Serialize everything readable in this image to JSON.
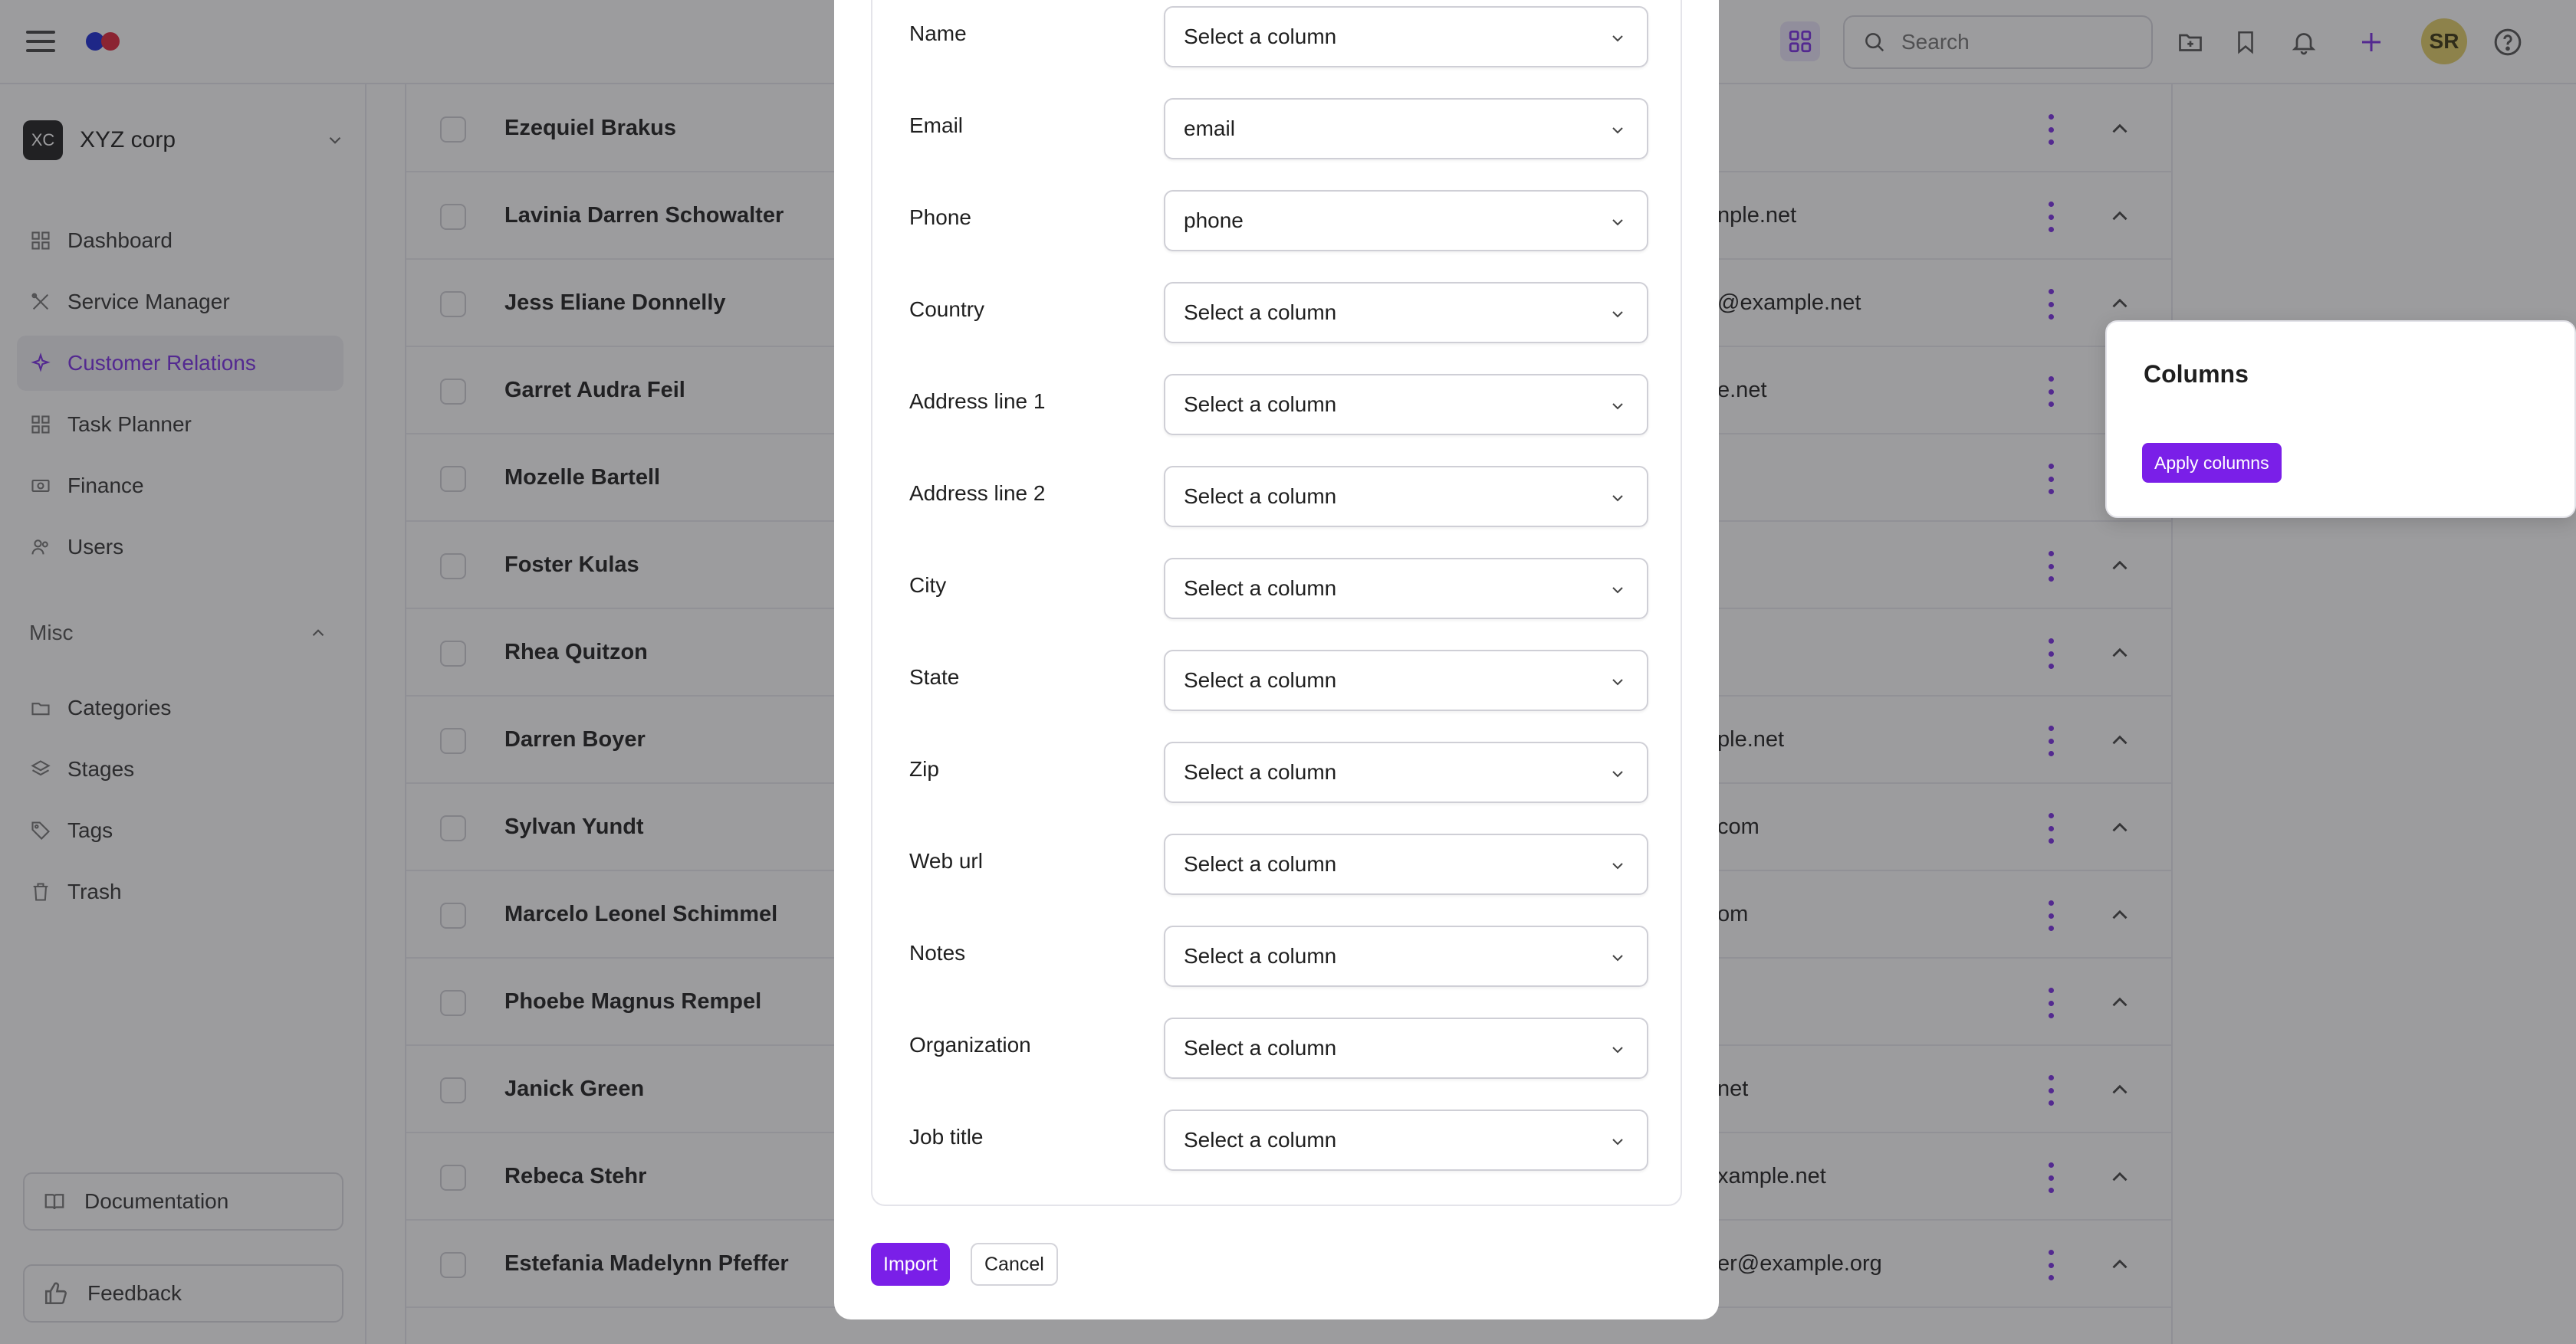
{
  "header": {
    "search_placeholder": "Search",
    "avatar_initials": "SR"
  },
  "sidebar": {
    "org_badge": "XC",
    "org_name": "XYZ corp",
    "nav": [
      {
        "label": "Dashboard",
        "icon": "grid-icon"
      },
      {
        "label": "Service Manager",
        "icon": "tools-icon"
      },
      {
        "label": "Customer Relations",
        "icon": "sparkle-icon",
        "active": true
      },
      {
        "label": "Task Planner",
        "icon": "grid-icon"
      },
      {
        "label": "Finance",
        "icon": "banknote-icon"
      },
      {
        "label": "Users",
        "icon": "users-icon"
      }
    ],
    "misc_label": "Misc",
    "misc": [
      {
        "label": "Categories",
        "icon": "folder-icon"
      },
      {
        "label": "Stages",
        "icon": "layers-icon"
      },
      {
        "label": "Tags",
        "icon": "tag-icon"
      },
      {
        "label": "Trash",
        "icon": "trash-icon"
      }
    ],
    "documentation": "Documentation",
    "feedback": "Feedback"
  },
  "table": {
    "rows": [
      {
        "name": "Ezequiel Brakus",
        "email": ""
      },
      {
        "name": "Lavinia Darren Schowalter",
        "email": "nple.net"
      },
      {
        "name": "Jess Eliane Donnelly",
        "email": "@example.net"
      },
      {
        "name": "Garret Audra Feil",
        "email": "e.net"
      },
      {
        "name": "Mozelle Bartell",
        "email": ""
      },
      {
        "name": "Foster Kulas",
        "email": ""
      },
      {
        "name": "Rhea Quitzon",
        "email": ""
      },
      {
        "name": "Darren Boyer",
        "email": "ple.net"
      },
      {
        "name": "Sylvan Yundt",
        "email": "com"
      },
      {
        "name": "Marcelo Leonel Schimmel",
        "email": "om"
      },
      {
        "name": "Phoebe Magnus Rempel",
        "email": ""
      },
      {
        "name": "Janick Green",
        "email": "net"
      },
      {
        "name": "Rebeca Stehr",
        "email": "xample.net"
      },
      {
        "name": "Estefania Madelynn Pfeffer",
        "email": "er@example.org"
      }
    ]
  },
  "columns_popover": {
    "title": "Columns",
    "apply_label": "Apply columns"
  },
  "import_modal": {
    "fields": [
      {
        "label": "Name",
        "value": "Select a column"
      },
      {
        "label": "Email",
        "value": "email"
      },
      {
        "label": "Phone",
        "value": "phone"
      },
      {
        "label": "Country",
        "value": "Select a column"
      },
      {
        "label": "Address line 1",
        "value": "Select a column"
      },
      {
        "label": "Address line 2",
        "value": "Select a column"
      },
      {
        "label": "City",
        "value": "Select a column"
      },
      {
        "label": "State",
        "value": "Select a column"
      },
      {
        "label": "Zip",
        "value": "Select a column"
      },
      {
        "label": "Web url",
        "value": "Select a column"
      },
      {
        "label": "Notes",
        "value": "Select a column"
      },
      {
        "label": "Organization",
        "value": "Select a column"
      },
      {
        "label": "Job title",
        "value": "Select a column"
      }
    ],
    "import_label": "Import",
    "cancel_label": "Cancel"
  },
  "colors": {
    "accent": "#7a1fe8",
    "overlay": "#232328"
  }
}
